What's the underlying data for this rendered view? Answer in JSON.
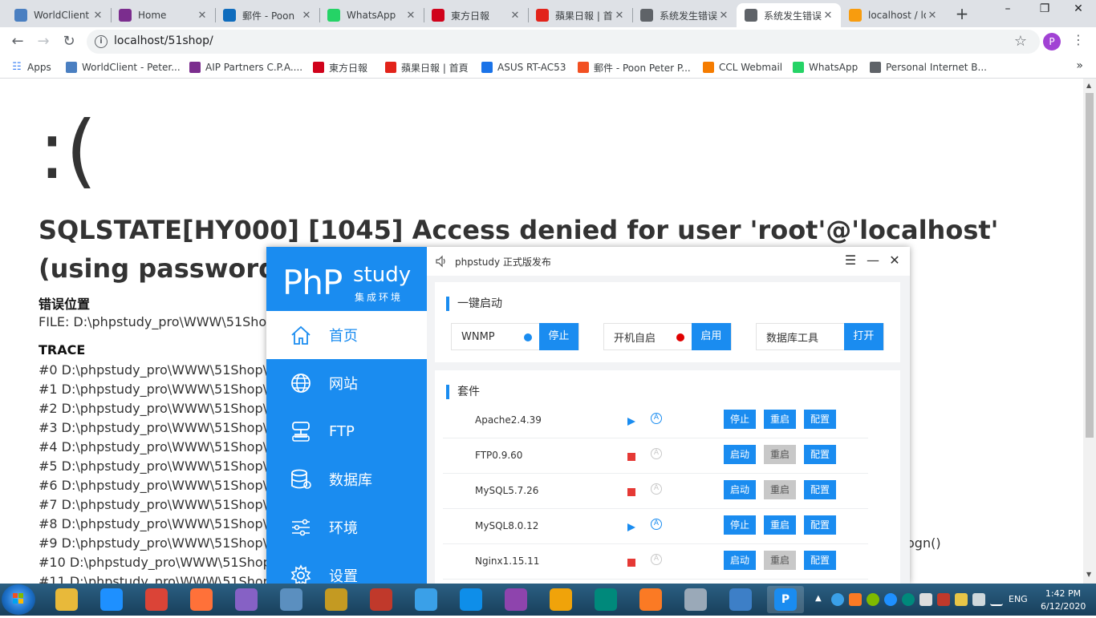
{
  "browser": {
    "tabs": [
      {
        "title": "WorldClient",
        "icon": "globe-icon",
        "color": "#4a7fc1"
      },
      {
        "title": "Home",
        "icon": "aip-icon",
        "color": "#7b2d8e"
      },
      {
        "title": "郵件 - Poon",
        "icon": "outlook-icon",
        "color": "#0f6cbd"
      },
      {
        "title": "WhatsApp",
        "icon": "whatsapp-icon",
        "color": "#25d366"
      },
      {
        "title": "東方日報",
        "icon": "oriental-daily-icon",
        "color": "#d0021b"
      },
      {
        "title": "蘋果日報 | 首",
        "icon": "apple-daily-icon",
        "color": "#e2231a"
      },
      {
        "title": "系统发生错误",
        "icon": "globe-icon",
        "color": "#5f6368"
      },
      {
        "title": "系统发生错误",
        "icon": "globe-icon",
        "color": "#5f6368",
        "active": true
      },
      {
        "title": "localhost / lo",
        "icon": "phpmyadmin-icon",
        "color": "#f89c0e"
      }
    ],
    "new_tab_label": "+",
    "url": "localhost/51shop/",
    "profile_initial": "P",
    "bookmarks": [
      {
        "label": "Apps",
        "icon": "apps-grid-icon",
        "color": "#4285f4"
      },
      {
        "label": "WorldClient - Peter...",
        "icon": "globe-icon",
        "color": "#4a7fc1"
      },
      {
        "label": "AIP Partners C.P.A....",
        "icon": "aip-icon",
        "color": "#7b2d8e"
      },
      {
        "label": "東方日報",
        "icon": "oriental-daily-icon",
        "color": "#d0021b"
      },
      {
        "label": "蘋果日報 | 首頁",
        "icon": "apple-daily-icon",
        "color": "#e2231a"
      },
      {
        "label": "ASUS RT-AC53",
        "icon": "router-icon",
        "color": "#1a73e8"
      },
      {
        "label": "郵件 - Poon Peter P...",
        "icon": "microsoft-icon",
        "color": "#f25022"
      },
      {
        "label": "CCL Webmail",
        "icon": "ccl-icon",
        "color": "#f57c00"
      },
      {
        "label": "WhatsApp",
        "icon": "whatsapp-icon",
        "color": "#25d366"
      },
      {
        "label": "Personal Internet B...",
        "icon": "globe-icon",
        "color": "#5f6368"
      }
    ],
    "more_bookmarks": "»"
  },
  "error_page": {
    "face": ":(",
    "message": "SQLSTATE[HY000] [1045] Access denied for user 'root'@'localhost' (using password: YES)",
    "location_heading": "错误位置",
    "file_line": "FILE: D:\\phpstudy_pro\\WWW\\51Shop",
    "trace_heading": "TRACE",
    "trace": [
      "#0 D:\\phpstudy_pro\\WWW\\51Shop\\T",
      "#1 D:\\phpstudy_pro\\WWW\\51Shop\\T",
      "#2 D:\\phpstudy_pro\\WWW\\51Shop\\T",
      "#3 D:\\phpstudy_pro\\WWW\\51Shop\\T",
      "#4 D:\\phpstudy_pro\\WWW\\51Shop\\T",
      "#5 D:\\phpstudy_pro\\WWW\\51Shop\\T",
      "#6 D:\\phpstudy_pro\\WWW\\51Shop\\T",
      "#7 D:\\phpstudy_pro\\WWW\\51Shop\\T",
      "#8 D:\\phpstudy_pro\\WWW\\51Shop\\A",
      "#9 D:\\phpstudy_pro\\WWW\\51Shop\\A",
      "#10 D:\\phpstudy_pro\\WWW\\51Shop\\",
      "#11 D:\\phpstudy_pro\\WWW\\51Shop\\"
    ],
    "trace_tail": "ogn()"
  },
  "phpstudy": {
    "logo_main": "PhP",
    "logo_study": "study",
    "logo_sub": "集成环境",
    "window_title": "phpstudy 正式版发布",
    "nav": [
      {
        "label": "首页",
        "icon": "home-icon",
        "active": true
      },
      {
        "label": "网站",
        "icon": "globe-icon"
      },
      {
        "label": "FTP",
        "icon": "server-icon"
      },
      {
        "label": "数据库",
        "icon": "database-icon"
      },
      {
        "label": "环境",
        "icon": "sliders-icon"
      },
      {
        "label": "设置",
        "icon": "gear-icon"
      }
    ],
    "quick_heading": "一键启动",
    "quick": [
      {
        "label": "WNMP",
        "dot_color": "#1a8cf0",
        "button": "停止"
      },
      {
        "label": "开机自启",
        "dot_color": "#e00000",
        "button": "启用"
      },
      {
        "label": "数据库工具",
        "button": "打开"
      }
    ],
    "suite_heading": "套件",
    "suites": [
      {
        "name": "Apache2.4.39",
        "running": true,
        "start_stop": "停止",
        "restart": "重启",
        "config": "配置",
        "restart_enabled": true
      },
      {
        "name": "FTP0.9.60",
        "running": false,
        "start_stop": "启动",
        "restart": "重启",
        "config": "配置",
        "restart_enabled": false
      },
      {
        "name": "MySQL5.7.26",
        "running": false,
        "start_stop": "启动",
        "restart": "重启",
        "config": "配置",
        "restart_enabled": false
      },
      {
        "name": "MySQL8.0.12",
        "running": true,
        "start_stop": "停止",
        "restart": "重启",
        "config": "配置",
        "restart_enabled": true
      },
      {
        "name": "Nginx1.15.11",
        "running": false,
        "start_stop": "启动",
        "restart": "重启",
        "config": "配置",
        "restart_enabled": false
      }
    ],
    "colors": {
      "accent": "#1a8cf0",
      "running": "#1a8cf0",
      "stopped": "#e53935"
    }
  },
  "taskbar": {
    "apps": [
      {
        "name": "file-explorer-icon",
        "color": "#e8b93a"
      },
      {
        "name": "internet-explorer-icon",
        "color": "#1e90ff"
      },
      {
        "name": "chrome-icon",
        "color": "#db4437"
      },
      {
        "name": "firefox-icon",
        "color": "#ff7139"
      },
      {
        "name": "visual-studio-icon",
        "color": "#8661c5"
      },
      {
        "name": "archive-icon",
        "color": "#5b8fbf"
      },
      {
        "name": "tools-icon",
        "color": "#c49a22"
      },
      {
        "name": "toolbox-icon",
        "color": "#c0392b"
      },
      {
        "name": "qq-icon",
        "color": "#3aa0e8"
      },
      {
        "name": "teamviewer-icon",
        "color": "#0e8ee9"
      },
      {
        "name": "usb-icon",
        "color": "#8e44ad"
      },
      {
        "name": "outlook-icon",
        "color": "#f0a30a"
      },
      {
        "name": "edraw-icon",
        "color": "#00897b"
      },
      {
        "name": "xampp-icon",
        "color": "#fb7a24"
      },
      {
        "name": "monitor-icon",
        "color": "#9aa9b8"
      },
      {
        "name": "control-panel-icon",
        "color": "#3d7fc7"
      },
      {
        "name": "phpstudy-taskbar-icon",
        "color": "#1a8cf0",
        "letter": "P"
      }
    ],
    "language": "ENG",
    "time": "1:42 PM",
    "date": "6/12/2020"
  }
}
